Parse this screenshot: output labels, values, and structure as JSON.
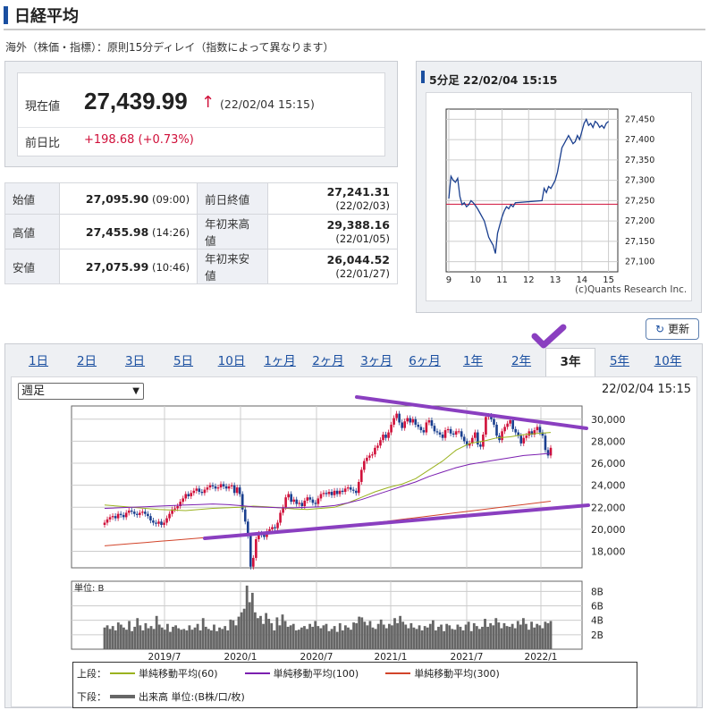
{
  "header": {
    "title": "日経平均",
    "notice": "海外（株価・指標）：原則15分ディレイ（指数によって異なります）"
  },
  "price": {
    "current_label": "現在値",
    "current_value": "27,439.99",
    "arrow": "↑",
    "current_time": "(22/02/04 15:15)",
    "change_label": "前日比",
    "change_value": "+198.68 (+0.73%)"
  },
  "quotes": [
    {
      "label": "始値",
      "value": "27,095.90",
      "time": "(09:00)",
      "label2": "前日終値",
      "value2": "27,241.31",
      "time2": "(22/02/03)"
    },
    {
      "label": "高値",
      "value": "27,455.98",
      "time": "(14:26)",
      "label2": "年初来高値",
      "value2": "29,388.16",
      "time2": "(22/01/05)"
    },
    {
      "label": "安値",
      "value": "27,075.99",
      "time": "(10:46)",
      "label2": "年初来安値",
      "value2": "26,044.52",
      "time2": "(22/01/27)"
    }
  ],
  "intraday": {
    "title": "5分足 22/02/04 15:15",
    "credit": "(c)Quants Research Inc."
  },
  "refresh_label": "更新",
  "tabs": [
    "1日",
    "2日",
    "3日",
    "5日",
    "10日",
    "1ヶ月",
    "2ヶ月",
    "3ヶ月",
    "6ヶ月",
    "1年",
    "2年",
    "3年",
    "5年",
    "10年"
  ],
  "active_tab": "3年",
  "period_select": {
    "selected": "週足"
  },
  "main_chart_timestamp": "22/02/04 15:15",
  "legend": {
    "upper_label": "上段：",
    "ma60": "単純移動平均(60)",
    "ma100": "単純移動平均(100)",
    "ma300": "単純移動平均(300)",
    "lower_label": "下段：",
    "volume": "出来高 単位:(B株/口/枚)"
  },
  "colors": {
    "up": "#d0103a",
    "down": "#1a3f8f",
    "ma60": "#9ab21f",
    "ma100": "#7b1fb0",
    "ma300": "#d2442a",
    "annotation": "#8a3fc0"
  },
  "chart_data": [
    {
      "type": "line",
      "title": "5分足 22/02/04 15:15",
      "x_ticks": [
        "9",
        "10",
        "11",
        "12",
        "13",
        "14",
        "15"
      ],
      "y_ticks": [
        27100,
        27150,
        27200,
        27250,
        27300,
        27350,
        27400,
        27450
      ],
      "ylim": [
        27075,
        27475
      ],
      "reference_line": 27241.31,
      "x": [
        9.0,
        9.083,
        9.167,
        9.25,
        9.333,
        9.417,
        9.5,
        9.583,
        9.667,
        9.75,
        9.833,
        9.917,
        10.0,
        10.083,
        10.167,
        10.25,
        10.333,
        10.417,
        10.5,
        10.583,
        10.667,
        10.75,
        10.833,
        10.917,
        11.0,
        11.083,
        11.167,
        11.25,
        11.333,
        11.417,
        11.5,
        12.5,
        12.583,
        12.667,
        12.75,
        12.833,
        12.917,
        13.0,
        13.083,
        13.167,
        13.25,
        13.333,
        13.417,
        13.5,
        13.583,
        13.667,
        13.75,
        13.833,
        13.917,
        14.0,
        14.083,
        14.167,
        14.25,
        14.333,
        14.417,
        14.5,
        14.583,
        14.667,
        14.75,
        14.833,
        14.917,
        15.0
      ],
      "values": [
        27255,
        27310,
        27300,
        27295,
        27305,
        27260,
        27240,
        27245,
        27235,
        27240,
        27250,
        27245,
        27238,
        27230,
        27220,
        27210,
        27200,
        27180,
        27160,
        27150,
        27140,
        27120,
        27170,
        27190,
        27210,
        27225,
        27235,
        27230,
        27240,
        27235,
        27245,
        27250,
        27280,
        27270,
        27285,
        27280,
        27290,
        27300,
        27320,
        27350,
        27380,
        27390,
        27400,
        27410,
        27400,
        27390,
        27395,
        27410,
        27400,
        27420,
        27440,
        27450,
        27435,
        27440,
        27430,
        27445,
        27440,
        27430,
        27435,
        27428,
        27440,
        27445
      ]
    },
    {
      "type": "line",
      "title": "",
      "subtype": "candlestick",
      "x_ticks": [
        "2019/7",
        "2020/1",
        "2020/7",
        "2021/1",
        "2021/7",
        "2022/1"
      ],
      "y_ticks": [
        18000,
        20000,
        22000,
        24000,
        26000,
        28000,
        30000
      ],
      "ylim": [
        16500,
        31200
      ],
      "volume_ticks": [
        "2B",
        "4B",
        "6B",
        "8B"
      ],
      "volume_unit_label": "単位: B",
      "series": [
        {
          "name": "週足",
          "values": [
            20600,
            20900,
            21100,
            21200,
            21000,
            21400,
            21300,
            21100,
            21500,
            21700,
            21600,
            21400,
            21300,
            21500,
            21600,
            21400,
            21200,
            20800,
            20600,
            20500,
            20700,
            20400,
            20600,
            21000,
            21400,
            21800,
            21900,
            22100,
            22500,
            22800,
            23200,
            23000,
            23300,
            23500,
            23700,
            23400,
            23300,
            23600,
            23800,
            24000,
            23900,
            23700,
            23800,
            24100,
            23900,
            23700,
            23900,
            24000,
            23300,
            23800,
            23200,
            21800,
            20700,
            19400,
            16600,
            17400,
            19100,
            19600,
            19500,
            19300,
            19800,
            20000,
            20200,
            20100,
            20600,
            21500,
            22000,
            22900,
            23200,
            22500,
            22700,
            22300,
            22400,
            22100,
            22600,
            22900,
            22700,
            22400,
            22300,
            22800,
            23200,
            23300,
            23200,
            23400,
            23100,
            23500,
            23200,
            23500,
            23400,
            23700,
            23800,
            23600,
            23500,
            23300,
            24300,
            25400,
            26200,
            26500,
            26700,
            26800,
            27400,
            27600,
            28100,
            28600,
            28300,
            28800,
            29500,
            30100,
            30500,
            29700,
            29200,
            29800,
            30100,
            29700,
            30000,
            29500,
            29300,
            29000,
            28800,
            29700,
            29900,
            29400,
            28900,
            28800,
            28600,
            28300,
            29000,
            29100,
            28700,
            28600,
            28900,
            28900,
            28400,
            28000,
            27600,
            27800,
            28300,
            28800,
            27700,
            27500,
            28600,
            30200,
            30300,
            30000,
            29500,
            28500,
            28100,
            28900,
            29300,
            29600,
            29900,
            29100,
            28800,
            28500,
            27800,
            28300,
            28500,
            28900,
            28600,
            29000,
            29300,
            28800,
            28500,
            27200,
            26700,
            27400
          ]
        },
        {
          "name": "単純移動平均(60)",
          "values": [
            22200,
            22100,
            22000,
            21900,
            21800,
            21750,
            21700,
            21800,
            21900,
            21950,
            22000,
            22100,
            22050,
            21950,
            21850,
            21800,
            21900,
            22000,
            22400,
            22900,
            23400,
            23800,
            24100,
            24600,
            25400,
            26200,
            27200,
            27800,
            28000,
            28300,
            28400,
            28600,
            28700,
            28800
          ]
        },
        {
          "name": "単純移動平均(100)",
          "values": [
            21900,
            21950,
            22000,
            22050,
            22100,
            22150,
            22200,
            22250,
            22300,
            22250,
            22150,
            22050,
            22000,
            21950,
            21950,
            22000,
            22050,
            22150,
            22400,
            22700,
            23100,
            23500,
            23900,
            24300,
            24800,
            25200,
            25600,
            25900,
            26100,
            26300,
            26500,
            26700,
            26800,
            26900
          ]
        },
        {
          "name": "単純移動平均(300)",
          "values": [
            18500,
            18600,
            18700,
            18800,
            18900,
            19000,
            19100,
            19200,
            19300,
            19400,
            19500,
            19600,
            19700,
            19800,
            19900,
            20000,
            20100,
            20200,
            20300,
            20450,
            20600,
            20750,
            20900,
            21050,
            21200,
            21350,
            21500,
            21650,
            21800,
            21950,
            22100,
            22250,
            22400,
            22550
          ]
        },
        {
          "name": "出来高",
          "values": [
            3.0,
            3.3,
            2.8,
            3.2,
            2.6,
            3.7,
            3.4,
            3.0,
            2.7,
            3.9,
            2.5,
            3.1,
            4.3,
            3.3,
            2.6,
            3.6,
            2.9,
            3.2,
            2.8,
            4.6,
            3.4,
            3.0,
            2.7,
            3.5,
            2.4,
            3.1,
            3.3,
            2.9,
            2.7,
            2.8,
            2.6,
            3.3,
            2.7,
            3.0,
            3.5,
            2.6,
            4.3,
            3.1,
            2.8,
            2.6,
            3.4,
            2.5,
            3.0,
            2.8,
            3.2,
            2.6,
            4.1,
            4.0,
            3.3,
            4.5,
            5.1,
            5.6,
            8.8,
            6.5,
            7.8,
            5.1,
            4.3,
            4.6,
            3.5,
            5.0,
            4.2,
            3.6,
            2.6,
            4.4,
            3.3,
            4.8,
            3.9,
            3.1,
            3.3,
            3.5,
            2.6,
            2.7,
            3.0,
            3.2,
            2.8,
            3.5,
            3.1,
            3.9,
            3.2,
            2.9,
            3.3,
            3.5,
            2.5,
            2.8,
            3.2,
            2.4,
            3.6,
            2.6,
            3.3,
            3.0,
            2.7,
            3.7,
            3.6,
            4.5,
            4.4,
            3.8,
            3.3,
            3.9,
            3.0,
            2.8,
            3.5,
            4.1,
            3.4,
            2.9,
            3.5,
            3.3,
            4.3,
            3.6,
            4.6,
            3.8,
            3.4,
            2.9,
            3.6,
            3.0,
            2.8,
            3.3,
            2.6,
            3.2,
            3.0,
            3.5,
            4.0,
            2.6,
            3.1,
            3.4,
            2.5,
            3.5,
            3.3,
            2.8,
            2.7,
            3.4,
            3.1,
            2.6,
            3.4,
            3.8,
            2.5,
            3.6,
            3.2,
            2.8,
            3.1,
            4.2,
            3.1,
            3.6,
            3.3,
            4.3,
            3.7,
            2.9,
            3.6,
            3.2,
            3.1,
            3.5,
            2.9,
            3.9,
            3.4,
            4.3,
            3.5,
            2.7,
            3.8,
            3.0,
            3.5,
            3.3,
            2.9,
            3.8,
            3.6,
            3.9
          ]
        }
      ]
    }
  ]
}
